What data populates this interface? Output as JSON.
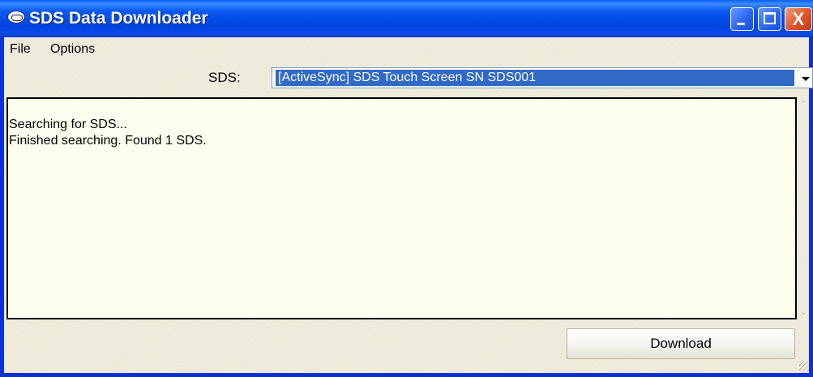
{
  "window": {
    "title": "SDS Data Downloader",
    "icons": {
      "app": "sds-app-icon",
      "minimize": "minimize-icon",
      "maximize": "maximize-icon",
      "close": "close-icon"
    },
    "close_glyph": "X"
  },
  "menu": {
    "items": [
      {
        "label": "File"
      },
      {
        "label": "Options"
      }
    ]
  },
  "device": {
    "label": "SDS:",
    "selected": "[ActiveSync] SDS Touch Screen SN SDS001"
  },
  "log": {
    "lines": [
      "Searching for SDS...",
      "Finished searching.  Found 1 SDS."
    ]
  },
  "actions": {
    "download_label": "Download"
  },
  "colors": {
    "titlebar": "#0054e3",
    "close_button": "#e0542a",
    "selection": "#316ac5",
    "log_background": "#fefeef",
    "window_face": "#ece9d8"
  }
}
